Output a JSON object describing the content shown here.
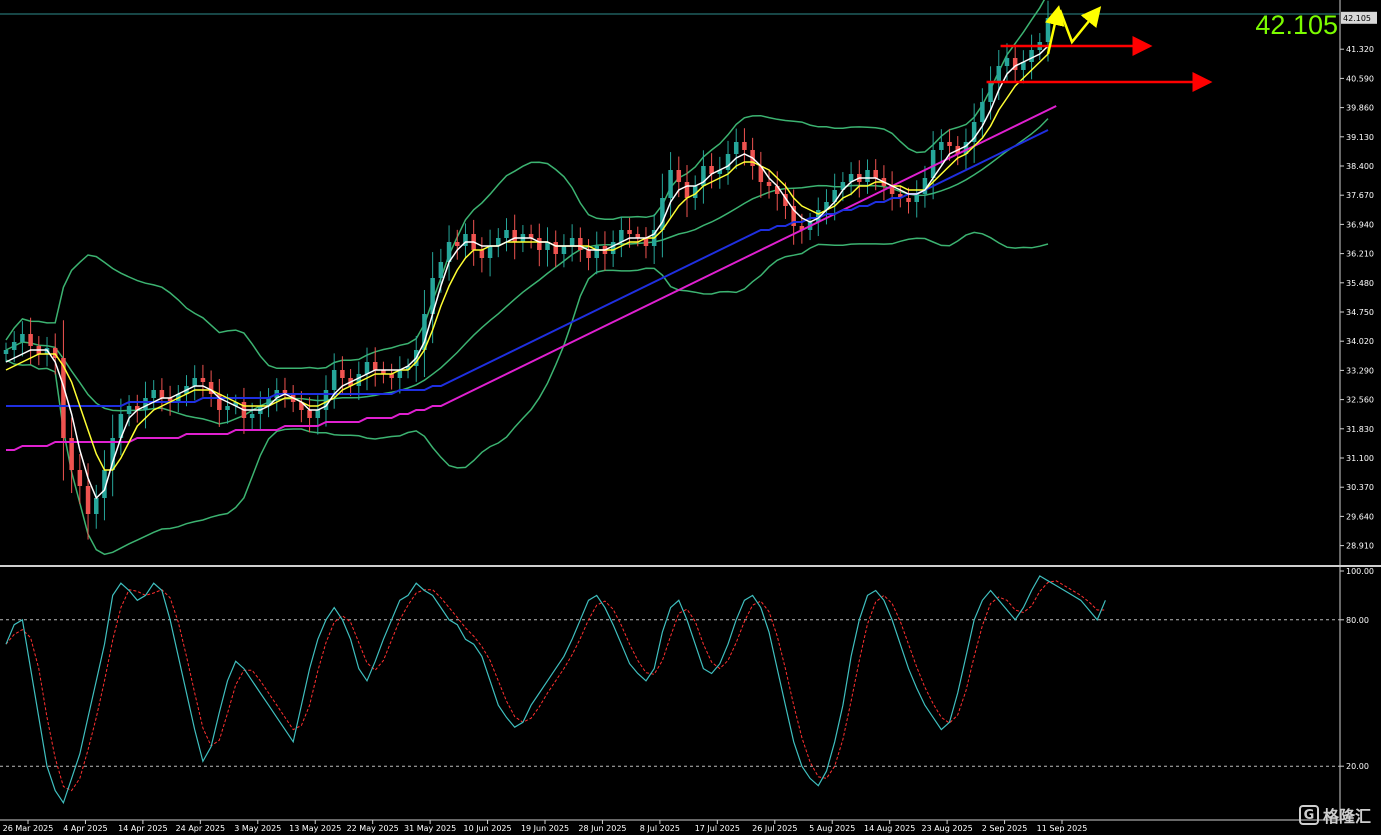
{
  "colors": {
    "background": "#000000",
    "bull": "#26a69a",
    "bear": "#ef5350",
    "bollinger": "#3cb371",
    "ma_white": "#ffffff",
    "ma_yellow": "#ffff33",
    "ma_blue": "#1f2fe0",
    "ma_magenta": "#e020d0",
    "stoch_main": "#3fbfbf",
    "stoch_signal": "#ff3030",
    "arrow_red": "#ff0000",
    "arrow_yellow": "#ffff00",
    "price_label": "#7CFC00"
  },
  "price": {
    "current": "42.105",
    "badge": "42.105"
  },
  "watermark": {
    "icon": "G",
    "text": "格隆汇"
  },
  "chart_data": [
    {
      "type": "candlestick",
      "panel": "price",
      "ylim": [
        28.5,
        42.2
      ],
      "y_ticks": [
        "41.320",
        "40.590",
        "39.860",
        "39.130",
        "38.400",
        "37.670",
        "36.940",
        "36.210",
        "35.480",
        "34.750",
        "34.020",
        "33.290",
        "32.560",
        "31.830",
        "31.100",
        "30.370",
        "29.640",
        "28.910"
      ],
      "x_ticks": [
        "26 Mar 2025",
        "4 Apr 2025",
        "14 Apr 2025",
        "24 Apr 2025",
        "3 May 2025",
        "13 May 2025",
        "22 May 2025",
        "31 May 2025",
        "10 Jun 2025",
        "19 Jun 2025",
        "28 Jun 2025",
        "8 Jul 2025",
        "17 Jul 2025",
        "26 Jul 2025",
        "5 Aug 2025",
        "14 Aug 2025",
        "23 Aug 2025",
        "2 Sep 2025",
        "11 Sep 2025"
      ],
      "close": [
        33.8,
        34.0,
        34.2,
        33.9,
        33.7,
        33.85,
        33.6,
        31.6,
        30.8,
        30.4,
        29.7,
        30.1,
        30.8,
        31.6,
        32.2,
        32.4,
        32.3,
        32.6,
        32.8,
        32.6,
        32.5,
        32.7,
        32.9,
        33.1,
        33.0,
        32.7,
        32.3,
        32.4,
        32.5,
        32.1,
        32.2,
        32.4,
        32.6,
        32.8,
        32.7,
        32.5,
        32.3,
        32.1,
        32.3,
        32.8,
        33.3,
        33.1,
        32.9,
        33.2,
        33.5,
        33.3,
        33.2,
        33.1,
        33.3,
        33.4,
        33.8,
        34.7,
        35.6,
        36.0,
        36.5,
        36.4,
        36.7,
        36.3,
        36.1,
        36.4,
        36.6,
        36.8,
        36.5,
        36.7,
        36.6,
        36.3,
        36.5,
        36.2,
        36.4,
        36.6,
        36.3,
        36.1,
        36.4,
        36.2,
        36.5,
        36.8,
        36.7,
        36.6,
        36.4,
        36.8,
        37.6,
        38.3,
        38.0,
        37.6,
        37.9,
        38.4,
        38.2,
        38.3,
        38.7,
        39.0,
        38.8,
        38.4,
        38.0,
        37.9,
        37.7,
        37.4,
        36.9,
        36.8,
        37.0,
        37.3,
        37.5,
        37.8,
        38.0,
        38.2,
        38.0,
        38.3,
        38.1,
        37.9,
        37.7,
        37.6,
        37.5,
        37.7,
        38.1,
        38.8,
        39.0,
        38.9,
        38.7,
        39.0,
        39.5,
        40.0,
        40.5,
        40.9,
        41.1,
        40.8,
        41.0,
        41.3,
        41.5,
        42.1
      ],
      "ma_white": [
        33.5,
        33.6,
        33.7,
        33.8,
        33.8,
        33.8,
        33.5,
        32.9,
        32.2,
        31.3,
        30.6,
        30.1,
        30.3,
        31.0,
        31.6,
        32.1,
        32.3,
        32.4,
        32.5,
        32.6,
        32.6,
        32.7,
        32.8,
        32.9,
        32.9,
        32.8,
        32.6,
        32.5,
        32.4,
        32.3,
        32.3,
        32.3,
        32.4,
        32.6,
        32.7,
        32.6,
        32.5,
        32.3,
        32.3,
        32.4,
        32.7,
        32.9,
        33.0,
        33.1,
        33.2,
        33.3,
        33.3,
        33.3,
        33.3,
        33.4,
        33.6,
        34.0,
        34.7,
        35.4,
        36.0,
        36.3,
        36.5,
        36.5,
        36.4,
        36.4,
        36.4,
        36.5,
        36.6,
        36.6,
        36.6,
        36.5,
        36.5,
        36.4,
        36.4,
        36.4,
        36.4,
        36.3,
        36.3,
        36.3,
        36.4,
        36.5,
        36.6,
        36.6,
        36.6,
        36.7,
        37.0,
        37.5,
        37.8,
        37.9,
        37.9,
        38.0,
        38.2,
        38.3,
        38.4,
        38.6,
        38.7,
        38.6,
        38.4,
        38.1,
        37.9,
        37.6,
        37.3,
        37.1,
        37.0,
        37.1,
        37.3,
        37.5,
        37.8,
        38.0,
        38.1,
        38.1,
        38.1,
        38.0,
        37.9,
        37.8,
        37.7,
        37.7,
        37.8,
        38.1,
        38.4,
        38.7,
        38.8,
        38.9,
        39.1,
        39.4,
        39.8,
        40.3,
        40.7,
        40.9,
        41.0,
        41.1,
        41.2,
        41.4
      ],
      "ma_yellow": [
        33.3,
        33.4,
        33.5,
        33.6,
        33.7,
        33.7,
        33.7,
        33.4,
        33.0,
        32.4,
        31.8,
        31.2,
        30.8,
        30.8,
        31.1,
        31.5,
        31.9,
        32.1,
        32.3,
        32.4,
        32.5,
        32.6,
        32.7,
        32.8,
        32.8,
        32.8,
        32.7,
        32.6,
        32.5,
        32.4,
        32.4,
        32.4,
        32.4,
        32.5,
        32.6,
        32.6,
        32.5,
        32.4,
        32.4,
        32.5,
        32.6,
        32.8,
        32.9,
        33.0,
        33.1,
        33.2,
        33.2,
        33.2,
        33.3,
        33.3,
        33.5,
        33.8,
        34.3,
        34.9,
        35.4,
        35.8,
        36.1,
        36.3,
        36.3,
        36.4,
        36.4,
        36.5,
        36.5,
        36.5,
        36.5,
        36.5,
        36.5,
        36.4,
        36.4,
        36.4,
        36.4,
        36.4,
        36.3,
        36.3,
        36.3,
        36.4,
        36.5,
        36.5,
        36.6,
        36.6,
        36.8,
        37.1,
        37.4,
        37.6,
        37.7,
        37.9,
        38.0,
        38.1,
        38.2,
        38.4,
        38.5,
        38.5,
        38.4,
        38.3,
        38.1,
        37.9,
        37.6,
        37.4,
        37.3,
        37.2,
        37.3,
        37.4,
        37.6,
        37.7,
        37.9,
        37.9,
        38.0,
        38.0,
        37.9,
        37.9,
        37.8,
        37.8,
        37.8,
        38.0,
        38.2,
        38.4,
        38.6,
        38.7,
        38.9,
        39.1,
        39.4,
        39.8,
        40.1,
        40.4,
        40.6,
        40.8,
        41.0,
        41.2
      ],
      "ma_blue": [
        32.4,
        32.4,
        32.4,
        32.4,
        32.4,
        32.4,
        32.4,
        32.4,
        32.4,
        32.4,
        32.4,
        32.4,
        32.4,
        32.4,
        32.4,
        32.5,
        32.5,
        32.5,
        32.5,
        32.5,
        32.5,
        32.5,
        32.5,
        32.5,
        32.6,
        32.6,
        32.6,
        32.6,
        32.6,
        32.6,
        32.6,
        32.6,
        32.6,
        32.7,
        32.7,
        32.7,
        32.7,
        32.7,
        32.7,
        32.7,
        32.7,
        32.7,
        32.7,
        32.7,
        32.7,
        32.7,
        32.7,
        32.7,
        32.8,
        32.8,
        32.8,
        32.8,
        32.9,
        32.9,
        33.0,
        33.1,
        33.2,
        33.3,
        33.4,
        33.5,
        33.6,
        33.7,
        33.8,
        33.9,
        34.0,
        34.1,
        34.2,
        34.3,
        34.4,
        34.5,
        34.6,
        34.7,
        34.8,
        34.9,
        35.0,
        35.1,
        35.2,
        35.3,
        35.4,
        35.5,
        35.6,
        35.7,
        35.8,
        35.9,
        36.0,
        36.1,
        36.2,
        36.3,
        36.4,
        36.5,
        36.6,
        36.7,
        36.8,
        36.8,
        36.9,
        36.9,
        37.0,
        37.0,
        37.1,
        37.1,
        37.2,
        37.2,
        37.3,
        37.3,
        37.4,
        37.4,
        37.5,
        37.5,
        37.6,
        37.6,
        37.7,
        37.7,
        37.8,
        37.9,
        38.0,
        38.1,
        38.2,
        38.3,
        38.4,
        38.5,
        38.6,
        38.7,
        38.8,
        38.9,
        39.0,
        39.1,
        39.2,
        39.3
      ],
      "ma_magenta": [
        31.3,
        31.3,
        31.4,
        31.4,
        31.4,
        31.4,
        31.5,
        31.5,
        31.5,
        31.5,
        31.5,
        31.5,
        31.5,
        31.5,
        31.5,
        31.5,
        31.6,
        31.6,
        31.6,
        31.6,
        31.6,
        31.6,
        31.7,
        31.7,
        31.7,
        31.7,
        31.7,
        31.7,
        31.8,
        31.8,
        31.8,
        31.8,
        31.8,
        31.8,
        31.9,
        31.9,
        31.9,
        31.9,
        31.9,
        32.0,
        32.0,
        32.0,
        32.0,
        32.0,
        32.1,
        32.1,
        32.1,
        32.1,
        32.2,
        32.2,
        32.3,
        32.3,
        32.4,
        32.4,
        32.5,
        32.6,
        32.7,
        32.8,
        32.9,
        33.0,
        33.1,
        33.2,
        33.3,
        33.4,
        33.5,
        33.6,
        33.7,
        33.8,
        33.9,
        34.0,
        34.1,
        34.2,
        34.3,
        34.4,
        34.5,
        34.6,
        34.7,
        34.8,
        34.9,
        35.0,
        35.1,
        35.2,
        35.3,
        35.4,
        35.5,
        35.6,
        35.7,
        35.8,
        35.9,
        36.0,
        36.1,
        36.2,
        36.3,
        36.4,
        36.5,
        36.6,
        36.7,
        36.8,
        36.9,
        37.0,
        37.1,
        37.2,
        37.3,
        37.4,
        37.5,
        37.6,
        37.7,
        37.8,
        37.9,
        38.0,
        38.1,
        38.2,
        38.3,
        38.4,
        38.5,
        38.6,
        38.7,
        38.8,
        38.9,
        39.0,
        39.1,
        39.2,
        39.3,
        39.4,
        39.5,
        39.6,
        39.7,
        39.8,
        39.9
      ]
    },
    {
      "type": "line",
      "panel": "stochastic",
      "ylim": [
        0,
        100
      ],
      "y_ticks": [
        "100.00",
        "80.00",
        "20.00"
      ],
      "levels": [
        80,
        20
      ],
      "main": [
        70,
        78,
        80,
        60,
        40,
        20,
        10,
        5,
        15,
        25,
        40,
        55,
        70,
        90,
        95,
        92,
        88,
        90,
        95,
        92,
        80,
        65,
        50,
        35,
        22,
        28,
        42,
        55,
        63,
        60,
        55,
        50,
        45,
        40,
        35,
        30,
        45,
        60,
        72,
        80,
        85,
        80,
        72,
        60,
        55,
        63,
        72,
        80,
        88,
        90,
        95,
        92,
        90,
        85,
        80,
        78,
        72,
        70,
        65,
        55,
        45,
        40,
        36,
        38,
        45,
        50,
        55,
        60,
        65,
        72,
        80,
        88,
        90,
        85,
        78,
        70,
        62,
        58,
        55,
        60,
        75,
        85,
        88,
        80,
        70,
        60,
        58,
        62,
        70,
        80,
        88,
        90,
        85,
        75,
        60,
        45,
        30,
        20,
        15,
        12,
        18,
        30,
        45,
        65,
        80,
        90,
        92,
        88,
        80,
        70,
        60,
        52,
        45,
        40,
        35,
        38,
        50,
        65,
        80,
        88,
        92,
        88,
        84,
        80,
        85,
        92,
        98,
        96,
        94,
        92,
        90,
        88,
        84,
        80,
        88
      ]
    }
  ],
  "annotations": [
    {
      "type": "arrow",
      "color": "red",
      "from": [
        41.4,
        "2 Sep 2025"
      ],
      "direction": "right"
    },
    {
      "type": "arrow",
      "color": "red",
      "from": [
        40.5,
        "2 Sep 2025"
      ],
      "direction": "right"
    },
    {
      "type": "zigzag-arrow",
      "color": "yellow",
      "direction": "up"
    }
  ]
}
